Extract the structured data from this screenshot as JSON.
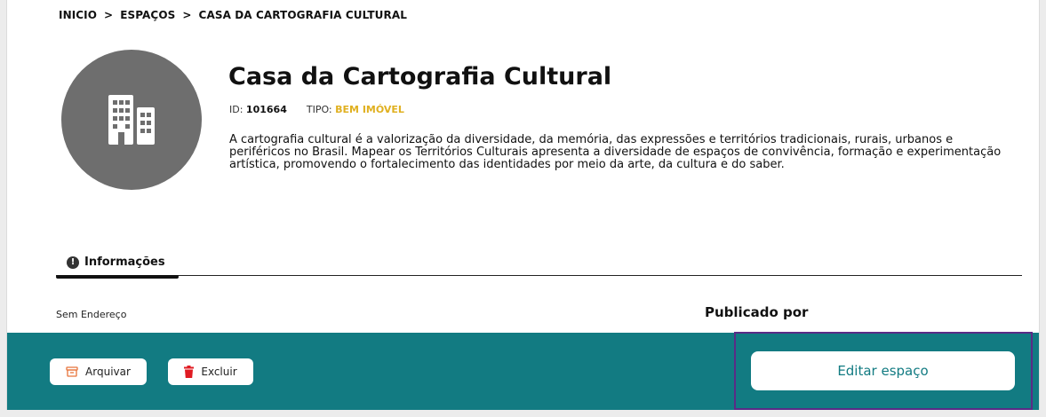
{
  "breadcrumb": {
    "home": "INICIO",
    "section": "ESPAÇOS",
    "current": "CASA DA CARTOGRAFIA CULTURAL",
    "separator": ">"
  },
  "space": {
    "title": "Casa da Cartografia Cultural",
    "id_label": "ID:",
    "id_value": "101664",
    "type_label": "TIPO:",
    "type_value": "BEM IMÓVEL",
    "description": "A cartografia cultural é a valorização da diversidade, da memória, das expressões e territórios tradicionais, rurais, urbanos e periféricos no Brasil. Mapear os Territórios Culturais apresenta a diversidade de espaços de convivência, formação e experimentação artística, promovendo o fortalecimento das identidades por meio da arte, da cultura e do saber.",
    "avatar_icon": "building-icon"
  },
  "tabs": [
    {
      "label": "Informações",
      "icon": "info-icon",
      "active": true
    }
  ],
  "details": {
    "address": "Sem Endereço",
    "published_by": "Publicado por"
  },
  "actions": {
    "archive_label": "Arquivar",
    "delete_label": "Excluir",
    "edit_label": "Editar espaço"
  },
  "colors": {
    "action_bar": "#127b82",
    "type_accent": "#e0b020",
    "delete_icon": "#e01b22",
    "archive_icon": "#e8733a",
    "highlight_border": "#5a2b86"
  }
}
